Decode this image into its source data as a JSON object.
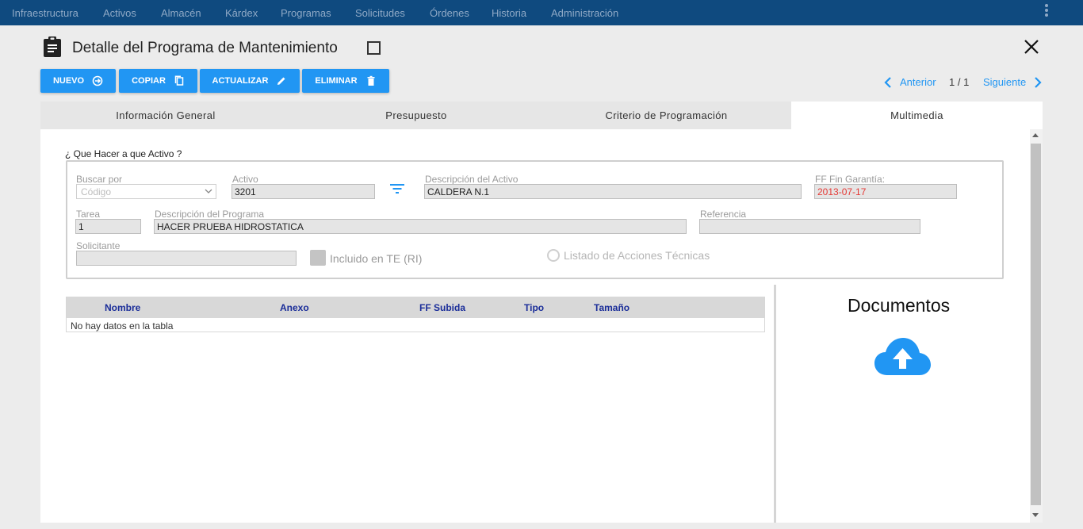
{
  "nav": {
    "items": [
      "Infraestructura",
      "Activos",
      "Almacén",
      "Kárdex",
      "Programas",
      "Solicitudes",
      "Órdenes",
      "Historia",
      "Administración"
    ]
  },
  "header": {
    "title": "Detalle del Programa de Mantenimiento"
  },
  "toolbar": {
    "nuevo": "NUEVO",
    "copiar": "COPIAR",
    "actualizar": "ACTUALIZAR",
    "eliminar": "ELIMINAR"
  },
  "pager": {
    "prev": "Anterior",
    "count": "1 / 1",
    "next": "Siguiente"
  },
  "tabs": [
    "Información General",
    "Presupuesto",
    "Criterio de Programación",
    "Multimedia"
  ],
  "active_tab": "Multimedia",
  "form": {
    "section_label": "¿ Que Hacer a que Activo ?",
    "buscar_por": {
      "label": "Buscar por",
      "placeholder": "Código"
    },
    "activo": {
      "label": "Activo",
      "value": "3201"
    },
    "descripcion_activo": {
      "label": "Descripción del Activo",
      "value": "CALDERA N.1"
    },
    "ff_fin_garantia": {
      "label": "FF Fin Garantía:",
      "value": "2013-07-17"
    },
    "tarea": {
      "label": "Tarea",
      "value": "1"
    },
    "descripcion_programa": {
      "label": "Descripción del Programa",
      "value": "HACER PRUEBA HIDROSTATICA"
    },
    "referencia": {
      "label": "Referencia",
      "value": ""
    },
    "solicitante": {
      "label": "Solicitante",
      "value": ""
    },
    "incluido_te": {
      "label": "Incluido en TE (RI)",
      "checked": false
    },
    "listado_acciones": {
      "label": "Listado de Acciones Técnicas",
      "selected": false
    }
  },
  "table": {
    "columns": [
      "Nombre",
      "Anexo",
      "FF Subida",
      "Tipo",
      "Tamaño"
    ],
    "empty_text": "No hay datos en la tabla"
  },
  "documents": {
    "title": "Documentos"
  },
  "colors": {
    "nav_bg": "#0f4a7f",
    "accent": "#2196f3",
    "header_text": "#1a2d99",
    "warning_text": "#e53935"
  }
}
